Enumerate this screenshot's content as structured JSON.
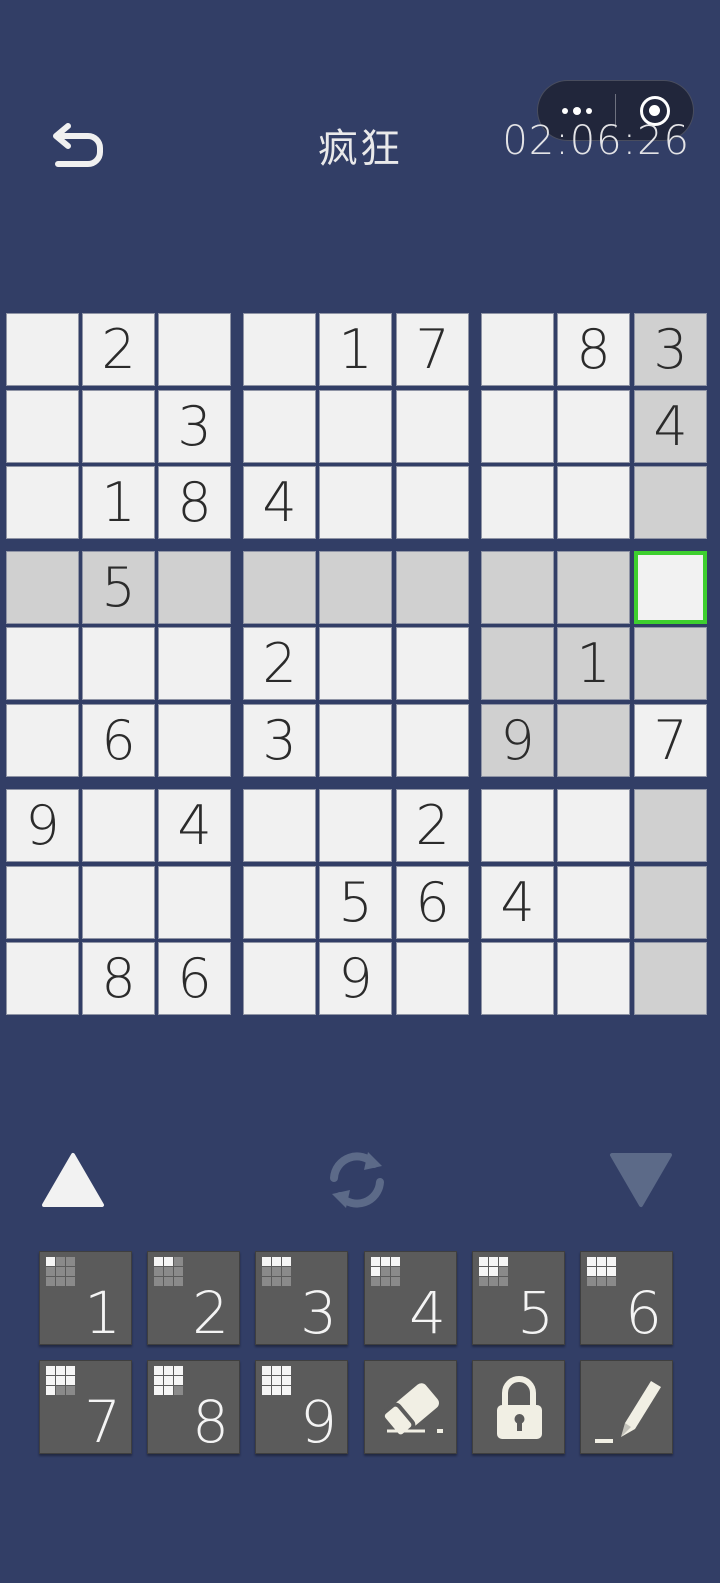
{
  "header": {
    "title": "疯狂",
    "timer": "02:06:26"
  },
  "icons": {
    "back": "back-arrow-icon",
    "more": "more-dots-icon",
    "close": "target-close-icon",
    "up": "triangle-up-icon",
    "down": "triangle-down-icon",
    "refresh": "refresh-icon",
    "erase": "eraser-icon",
    "lock": "lock-icon",
    "pencil": "pencil-icon"
  },
  "colors": {
    "background": "#323e66",
    "cell": "#f1f1f1",
    "highlight": "#d0d0d0",
    "selected_border": "#3ecf2f",
    "key": "#5b5b5b"
  },
  "board": {
    "rows": [
      [
        "",
        "2",
        "",
        "",
        "1",
        "7",
        "",
        "8",
        "3"
      ],
      [
        "",
        "",
        "3",
        "",
        "",
        "",
        "",
        "",
        "4"
      ],
      [
        "",
        "1",
        "8",
        "4",
        "",
        "",
        "",
        "",
        ""
      ],
      [
        "",
        "5",
        "",
        "",
        "",
        "",
        "",
        "",
        ""
      ],
      [
        "",
        "",
        "",
        "2",
        "",
        "",
        "",
        "1",
        ""
      ],
      [
        "",
        "6",
        "",
        "3",
        "",
        "",
        "9",
        "",
        "7"
      ],
      [
        "9",
        "",
        "4",
        "",
        "",
        "2",
        "",
        "",
        ""
      ],
      [
        "",
        "",
        "",
        "",
        "5",
        "6",
        "4",
        "",
        ""
      ],
      [
        "",
        "8",
        "6",
        "",
        "9",
        "",
        "",
        "",
        ""
      ]
    ],
    "selected": [
      3,
      8
    ]
  },
  "keypad": {
    "numbers": [
      "1",
      "2",
      "3",
      "4",
      "5",
      "6",
      "7",
      "8",
      "9"
    ]
  }
}
